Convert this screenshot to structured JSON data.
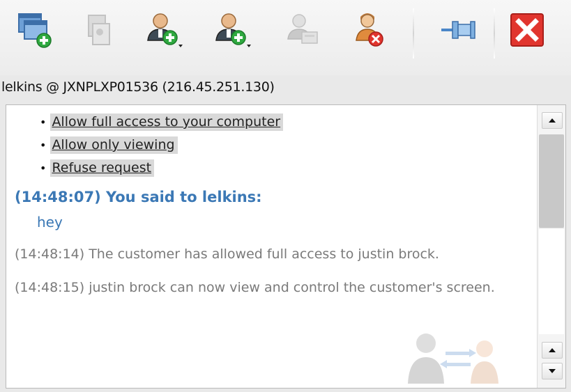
{
  "toolbar": {
    "buttons": [
      {
        "name": "new-session-icon",
        "enabled": true
      },
      {
        "name": "session-info-icon",
        "enabled": false
      },
      {
        "name": "add-user-icon",
        "enabled": true
      },
      {
        "name": "transfer-user-icon",
        "enabled": true
      },
      {
        "name": "user-print-icon",
        "enabled": false
      },
      {
        "name": "remove-user-icon",
        "enabled": true
      },
      {
        "name": "pin-icon",
        "enabled": true
      },
      {
        "name": "close-icon",
        "enabled": true
      }
    ]
  },
  "session": {
    "label": "lelkins @ JXNPLXP01536 (216.45.251.130)"
  },
  "chat": {
    "options": [
      "Allow full access to your computer",
      "Allow only viewing",
      "Refuse request"
    ],
    "said_header": "(14:48:07) You said to lelkins:",
    "said_message": "hey",
    "system_messages": [
      "(14:48:14) The customer has allowed full access to justin brock.",
      "(14:48:15) justin brock can now view and control the customer's screen."
    ]
  },
  "colors": {
    "accent_blue": "#3b78b5",
    "system_gray": "#7a7a7a",
    "close_red": "#e1352e"
  }
}
